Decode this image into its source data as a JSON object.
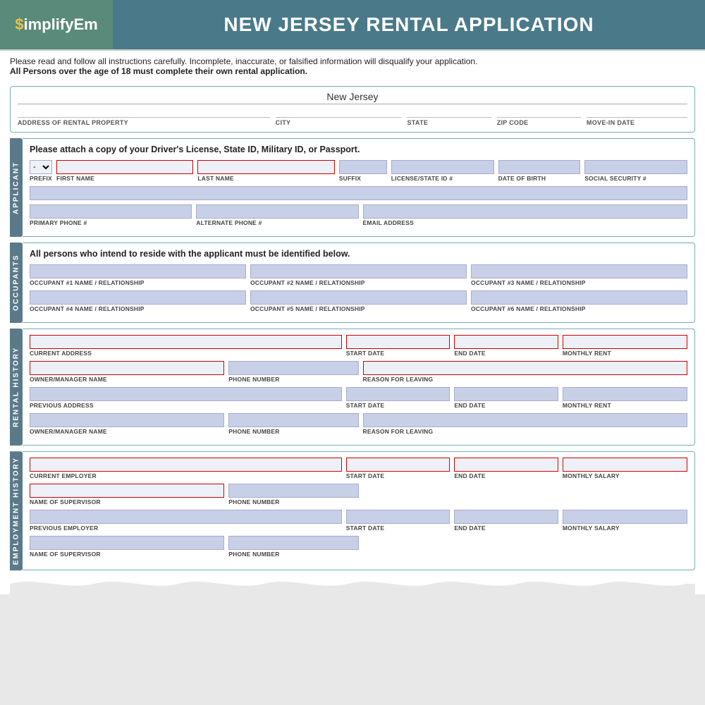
{
  "header": {
    "logo": "$implifyEm",
    "title": "NEW JERSEY RENTAL APPLICATION"
  },
  "notice": {
    "line1": "Please read and follow all instructions carefully. Incomplete, inaccurate, or falsified information will disqualify your application.",
    "line2": "All Persons over the age of 18 must complete their own rental application."
  },
  "property": {
    "state": "New Jersey",
    "fields": [
      {
        "label": "ADDRESS OF RENTAL PROPERTY"
      },
      {
        "label": "CITY"
      },
      {
        "label": "STATE"
      },
      {
        "label": "ZIP CODE"
      },
      {
        "label": "MOVE-IN DATE"
      }
    ]
  },
  "applicant": {
    "tab": "APPLICANT",
    "intro": "Please attach a copy of your Driver's License, State ID, Military ID, or Passport.",
    "fields": {
      "prefix": "-",
      "first_name": {
        "label": "FIRST NAME",
        "placeholder": ""
      },
      "last_name": {
        "label": "LAST NAME",
        "placeholder": ""
      },
      "suffix": {
        "label": "SUFFIX"
      },
      "license_id": {
        "label": "LICENSE/STATE ID #"
      },
      "dob": {
        "label": "DATE OF BIRTH"
      },
      "ssn": {
        "label": "SOCIAL SECURITY #"
      },
      "primary_phone": {
        "label": "PRIMARY PHONE #"
      },
      "alt_phone": {
        "label": "ALTERNATE PHONE #"
      },
      "email": {
        "label": "EMAIL ADDRESS"
      }
    }
  },
  "occupants": {
    "tab": "OCCUPANTS",
    "intro": "All persons who intend to reside with the applicant must be identified below.",
    "fields": [
      {
        "label": "OCCUPANT #1 NAME / RELATIONSHIP"
      },
      {
        "label": "OCCUPANT #2 NAME / RELATIONSHIP"
      },
      {
        "label": "OCCUPANT #3 NAME / RELATIONSHIP"
      },
      {
        "label": "OCCUPANT #4 NAME / RELATIONSHIP"
      },
      {
        "label": "OCCUPANT #5 NAME / RELATIONSHIP"
      },
      {
        "label": "OCCUPANT #6 NAME / RELATIONSHIP"
      }
    ]
  },
  "rental_history": {
    "tab": "RENTAL HISTORY",
    "rows": [
      {
        "address_label": "CURRENT ADDRESS",
        "start_label": "START DATE",
        "end_label": "END DATE",
        "rent_label": "MONTHLY RENT",
        "owner_label": "OWNER/MANAGER NAME",
        "phone_label": "PHONE NUMBER",
        "reason_label": "REASON FOR LEAVING"
      },
      {
        "address_label": "PREVIOUS ADDRESS",
        "start_label": "START DATE",
        "end_label": "END DATE",
        "rent_label": "MONTHLY RENT",
        "owner_label": "OWNER/MANAGER NAME",
        "phone_label": "PHONE NUMBER",
        "reason_label": "REASON FOR LEAVING"
      }
    ]
  },
  "employment_history": {
    "tab": "EMPLOYMENT HISTORY",
    "rows": [
      {
        "employer_label": "CURRENT EMPLOYER",
        "start_label": "START DATE",
        "end_label": "END DATE",
        "salary_label": "MONTHLY SALARY",
        "supervisor_label": "NAME OF SUPERVISOR",
        "phone_label": "PHONE NUMBER"
      },
      {
        "employer_label": "PREVIOUS EMPLOYER",
        "start_label": "START DATE",
        "end_label": "END DATE",
        "salary_label": "MONTHLY SALARY",
        "supervisor_label": "NAME OF SUPERVISOR",
        "phone_label": "PHONE NUMBER"
      }
    ]
  }
}
